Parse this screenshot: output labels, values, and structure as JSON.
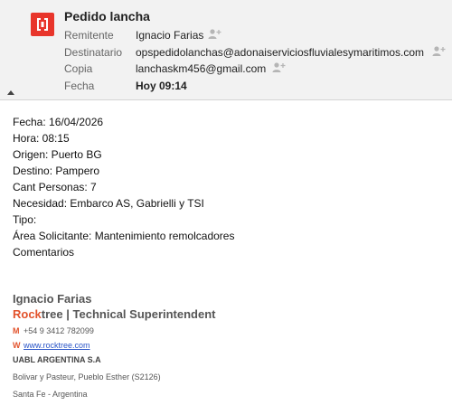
{
  "header": {
    "subject": "Pedido lancha",
    "from_label": "Remitente",
    "from_value": "Ignacio Farias",
    "to_label": "Destinatario",
    "to_value": "opspedidolanchas@adonaiserviciosfluvialesymaritimos.com",
    "cc_label": "Copia",
    "cc_value": "lanchaskm456@gmail.com",
    "date_label": "Fecha",
    "date_value": "Hoy 09:14"
  },
  "body": {
    "lines": [
      "Fecha: 16/04/2026",
      "Hora: 08:15",
      "Origen: Puerto BG",
      "Destino: Pampero",
      "Cant Personas: 7",
      "Necesidad: Embarco AS, Gabrielli y TSI",
      "Tipo:",
      "Área Solicitante: Mantenimiento remolcadores",
      "Comentarios"
    ]
  },
  "signature": {
    "name": "Ignacio Farias",
    "brand_rock": "Rock",
    "brand_tree": "tree",
    "separator": "|",
    "role": "Technical Superintendent",
    "mobile_letter": "M",
    "mobile": "+54 9 3412 782099",
    "web_letter": "W",
    "web": "www.rocktree.com",
    "company": "UABL ARGENTINA S.A",
    "address1": "Bolivar y Pasteur, Pueblo Esther (S2126)",
    "address2": "Santa Fe - Argentina"
  },
  "colors": {
    "accent_red": "#e8352b",
    "brand_orange": "#e2522b",
    "link_blue": "#2a55c7"
  }
}
